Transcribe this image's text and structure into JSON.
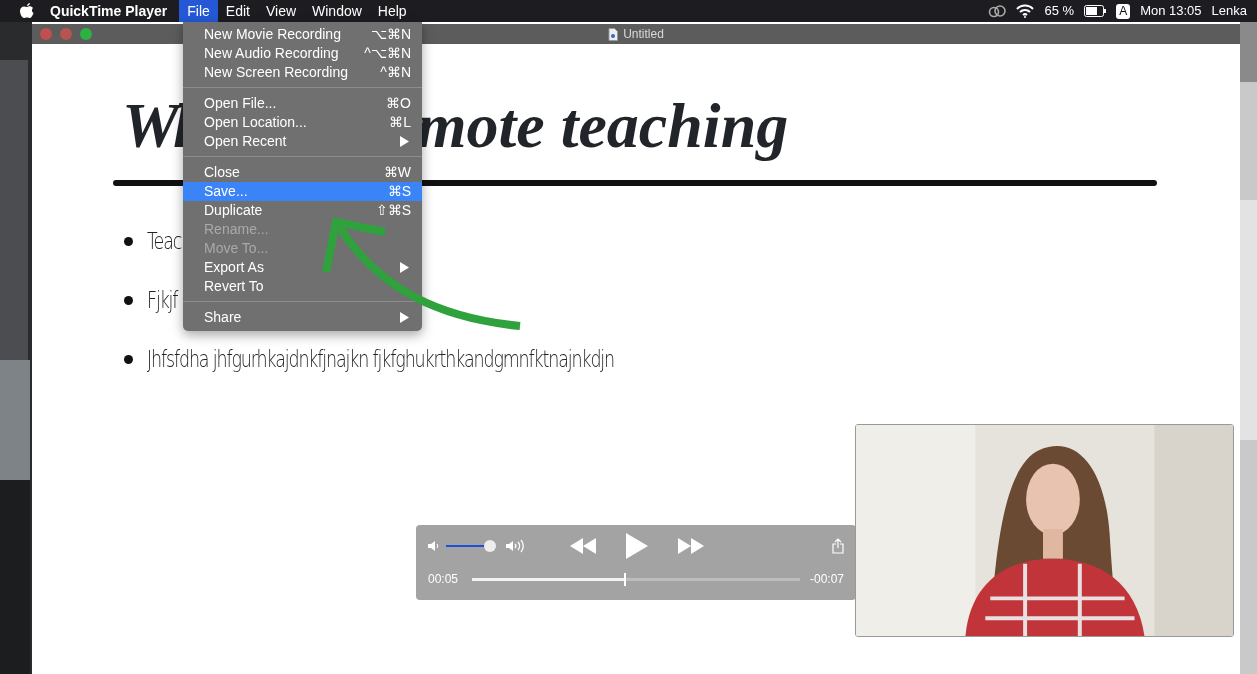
{
  "menubar": {
    "app": "QuickTime Player",
    "menus": [
      {
        "label": "File",
        "selected": true
      },
      {
        "label": "Edit",
        "selected": false
      },
      {
        "label": "View",
        "selected": false
      },
      {
        "label": "Window",
        "selected": false
      },
      {
        "label": "Help",
        "selected": false
      }
    ],
    "battery_text": "65 %",
    "input_source": "A",
    "clock": "Mon 13:05",
    "user": "Lenka"
  },
  "window": {
    "title": "Untitled"
  },
  "file_menu": [
    {
      "kind": "item",
      "label": "New Movie Recording",
      "shortcut": "⌥⌘N",
      "selected": false,
      "disabled": false,
      "submenu": false
    },
    {
      "kind": "item",
      "label": "New Audio Recording",
      "shortcut": "^⌥⌘N",
      "selected": false,
      "disabled": false,
      "submenu": false
    },
    {
      "kind": "item",
      "label": "New Screen Recording",
      "shortcut": "^⌘N",
      "selected": false,
      "disabled": false,
      "submenu": false
    },
    {
      "kind": "separator"
    },
    {
      "kind": "item",
      "label": "Open File...",
      "shortcut": "⌘O",
      "selected": false,
      "disabled": false,
      "submenu": false
    },
    {
      "kind": "item",
      "label": "Open Location...",
      "shortcut": "⌘L",
      "selected": false,
      "disabled": false,
      "submenu": false
    },
    {
      "kind": "item",
      "label": "Open Recent",
      "selected": false,
      "disabled": false,
      "submenu": true
    },
    {
      "kind": "separator"
    },
    {
      "kind": "item",
      "label": "Close",
      "shortcut": "⌘W",
      "selected": false,
      "disabled": false,
      "submenu": false
    },
    {
      "kind": "item",
      "label": "Save...",
      "shortcut": "⌘S",
      "selected": true,
      "disabled": false,
      "submenu": false
    },
    {
      "kind": "item",
      "label": "Duplicate",
      "shortcut": "⇧⌘S",
      "selected": false,
      "disabled": false,
      "submenu": false
    },
    {
      "kind": "item",
      "label": "Rename...",
      "selected": false,
      "disabled": true,
      "submenu": false
    },
    {
      "kind": "item",
      "label": "Move To...",
      "selected": false,
      "disabled": true,
      "submenu": false
    },
    {
      "kind": "item",
      "label": "Export As",
      "selected": false,
      "disabled": false,
      "submenu": true
    },
    {
      "kind": "item",
      "label": "Revert To",
      "selected": false,
      "disabled": false,
      "submenu": false
    },
    {
      "kind": "separator"
    },
    {
      "kind": "item",
      "label": "Share",
      "selected": false,
      "disabled": false,
      "submenu": true
    }
  ],
  "slide": {
    "heading_parts": [
      "Wl",
      "mote teaching"
    ],
    "bullets": [
      "Teac",
      "Fjkjf",
      "Jhfsfdha jhfgurhkajdnkfjnajkn fjkfghukrthkandgmnfktnajnkdjn"
    ]
  },
  "player": {
    "volume": {
      "level": 1.0
    },
    "elapsed": "00:05",
    "progress": {
      "level": 0.47
    },
    "remaining": "-00:07"
  }
}
